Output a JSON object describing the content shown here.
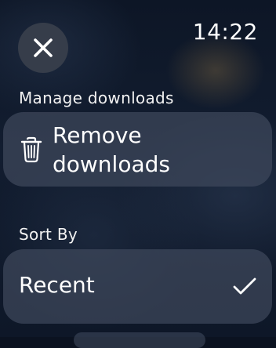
{
  "status": {
    "time": "14:22"
  },
  "manage": {
    "section_label": "Manage downloads",
    "remove_label_line1": "Remove",
    "remove_label_line2": "downloads",
    "icon": "trash-icon"
  },
  "sort": {
    "section_label": "Sort By",
    "selected_option": "Recent",
    "selected_icon": "checkmark-icon"
  },
  "close": {
    "icon": "close-icon"
  }
}
